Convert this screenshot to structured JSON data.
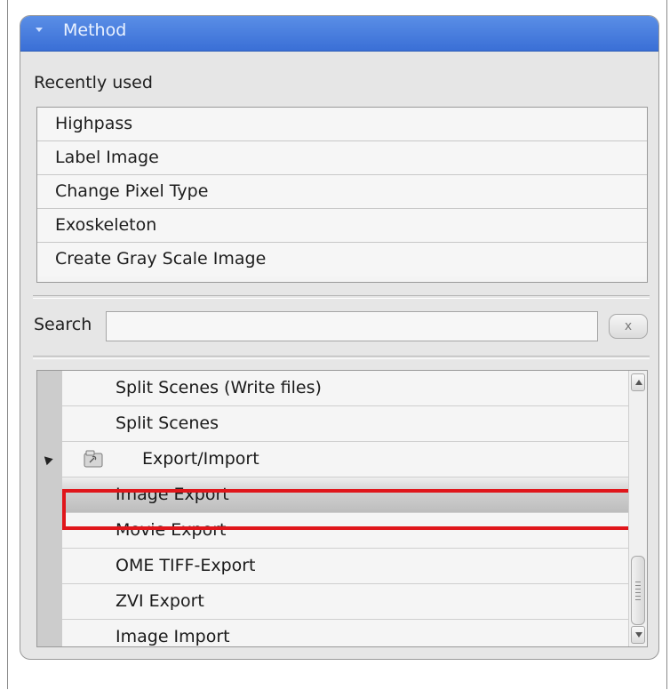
{
  "panel": {
    "title": "Method",
    "recent_label": "Recently used",
    "recent_items": [
      "Highpass",
      "Label Image",
      "Change Pixel Type",
      "Exoskeleton",
      "Create Gray Scale Image"
    ],
    "search": {
      "label": "Search",
      "value": "",
      "placeholder": "",
      "clear_label": "x"
    },
    "tree": {
      "rows": [
        {
          "label": "Split Scenes (Write files)",
          "type": "item"
        },
        {
          "label": "Split Scenes",
          "type": "item"
        },
        {
          "label": "Export/Import",
          "type": "group",
          "expanded": true
        },
        {
          "label": "Image Export",
          "type": "item",
          "selected": true
        },
        {
          "label": "Movie Export",
          "type": "item"
        },
        {
          "label": "OME TIFF-Export",
          "type": "item"
        },
        {
          "label": "ZVI Export",
          "type": "item"
        },
        {
          "label": "Image Import",
          "type": "item"
        }
      ]
    }
  },
  "colors": {
    "header": "#3a6fd6",
    "highlight": "#e0161b"
  }
}
